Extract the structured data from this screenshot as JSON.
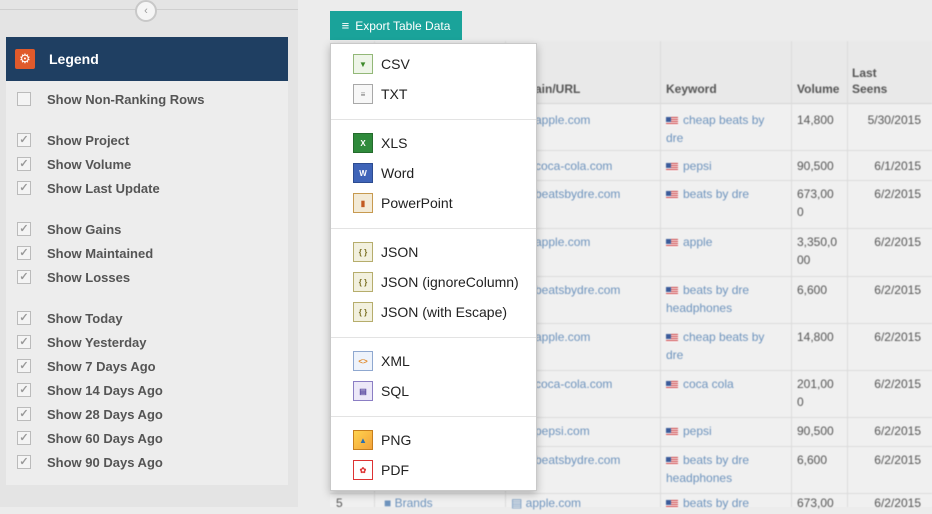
{
  "sidebar": {
    "legend_title": "Legend",
    "options": [
      {
        "label": "Show Non-Ranking Rows",
        "checked": false
      },
      {
        "label": "Show Project",
        "checked": true
      },
      {
        "label": "Show Volume",
        "checked": true
      },
      {
        "label": "Show Last Update",
        "checked": true
      },
      {
        "label": "Show Gains",
        "checked": true
      },
      {
        "label": "Show Maintained",
        "checked": true
      },
      {
        "label": "Show Losses",
        "checked": true
      },
      {
        "label": "Show Today",
        "checked": true
      },
      {
        "label": "Show Yesterday",
        "checked": true
      },
      {
        "label": "Show 7 Days Ago",
        "checked": true
      },
      {
        "label": "Show 14 Days Ago",
        "checked": true
      },
      {
        "label": "Show 28 Days Ago",
        "checked": true
      },
      {
        "label": "Show 60 Days Ago",
        "checked": true
      },
      {
        "label": "Show 90 Days Ago",
        "checked": true
      }
    ]
  },
  "export": {
    "button_label": "Export Table Data",
    "menu": {
      "csv": "CSV",
      "txt": "TXT",
      "xls": "XLS",
      "word": "Word",
      "powerpoint": "PowerPoint",
      "json": "JSON",
      "json_ignore": "JSON (ignoreColumn)",
      "json_escape": "JSON (with Escape)",
      "xml": "XML",
      "sql": "SQL",
      "png": "PNG",
      "pdf": "PDF"
    }
  },
  "table": {
    "headers": {
      "domain": "ain/URL",
      "keyword": "Keyword",
      "volume": "Volume",
      "last_seen_1": "Last",
      "last_seen_2": "Seens"
    },
    "rows": [
      {
        "url": "apple.com",
        "kw1": "cheap beats by",
        "kw2": "dre",
        "vol1": "14,800",
        "vol2": "",
        "date": "5/30/2015"
      },
      {
        "url": "coca-cola.com",
        "kw1": "pepsi",
        "kw2": "",
        "vol1": "90,500",
        "vol2": "",
        "date": "6/1/2015"
      },
      {
        "url": "beatsbydre.com",
        "kw1": "beats by dre",
        "kw2": "",
        "vol1": "673,00",
        "vol2": "0",
        "date": "6/2/2015"
      },
      {
        "url": "apple.com",
        "kw1": "apple",
        "kw2": "",
        "vol1": "3,350,0",
        "vol2": "00",
        "date": "6/2/2015"
      },
      {
        "url": "beatsbydre.com",
        "kw1": "beats by dre",
        "kw2": "headphones",
        "vol1": "6,600",
        "vol2": "",
        "date": "6/2/2015"
      },
      {
        "url": "apple.com",
        "kw1": "cheap beats by",
        "kw2": "dre",
        "vol1": "14,800",
        "vol2": "",
        "date": "6/2/2015"
      },
      {
        "url": "coca-cola.com",
        "kw1": "coca cola",
        "kw2": "",
        "vol1": "201,00",
        "vol2": "0",
        "date": "6/2/2015"
      },
      {
        "url": "pepsi.com",
        "kw1": "pepsi",
        "kw2": "",
        "vol1": "90,500",
        "vol2": "",
        "date": "6/2/2015"
      },
      {
        "url": "beatsbydre.com",
        "kw1": "beats by dre",
        "kw2": "headphones",
        "vol1": "6,600",
        "vol2": "",
        "date": "6/2/2015"
      },
      {
        "url": "apple.com",
        "kw1": "beats by dre",
        "kw2": "",
        "vol1": "673,00",
        "vol2": "",
        "date": "6/2/2015",
        "rank": "5",
        "project": "Brands"
      }
    ]
  }
}
